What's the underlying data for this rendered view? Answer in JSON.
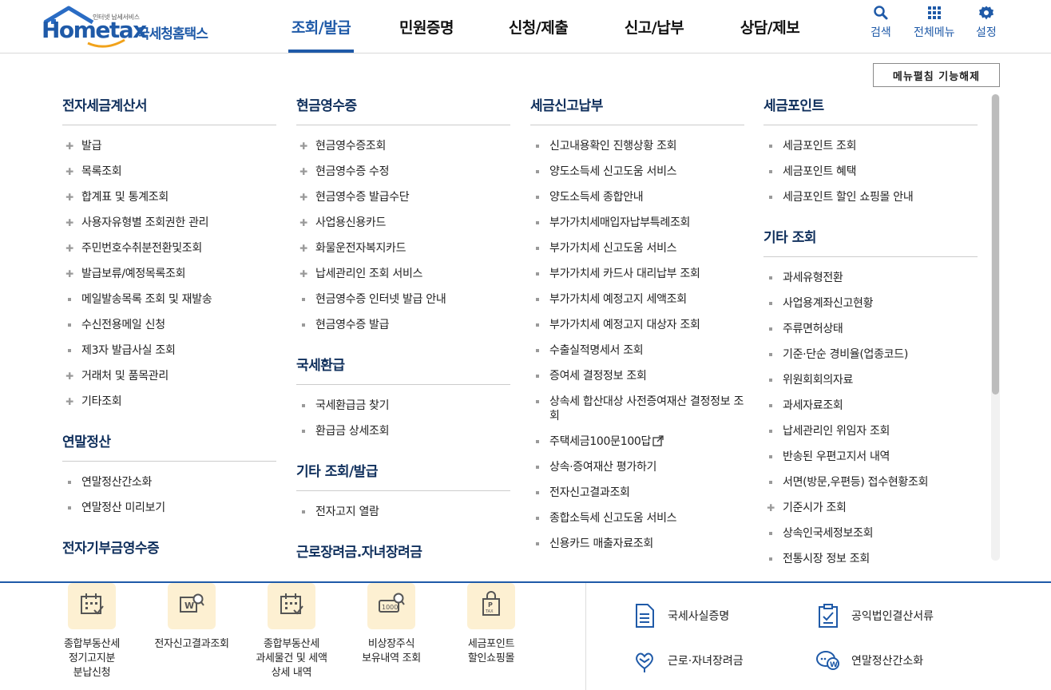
{
  "header": {
    "logo_tagline": "인터넷 납세서비스",
    "logo_en": "Hometax",
    "logo_ko": "국세청홈택스",
    "nav": [
      "조회/발급",
      "민원증명",
      "신청/제출",
      "신고/납부",
      "상담/제보"
    ],
    "active_nav": "조회/발급",
    "utils": {
      "search": "검색",
      "all_menu": "전체메뉴",
      "settings": "설정"
    }
  },
  "fold_button": "메뉴펼침 기능해제",
  "columns": [
    {
      "sections": [
        {
          "title": "전자세금계산서",
          "items": [
            {
              "label": "발급",
              "bullet": "plus"
            },
            {
              "label": "목록조회",
              "bullet": "plus"
            },
            {
              "label": "합계표 및 통계조회",
              "bullet": "plus"
            },
            {
              "label": "사용자유형별 조회권한 관리",
              "bullet": "plus"
            },
            {
              "label": "주민번호수취분전환및조회",
              "bullet": "plus"
            },
            {
              "label": "발급보류/예정목록조회",
              "bullet": "plus"
            },
            {
              "label": "메일발송목록 조회 및 재발송",
              "bullet": "dot"
            },
            {
              "label": "수신전용메일 신청",
              "bullet": "dot"
            },
            {
              "label": "제3자 발급사실 조회",
              "bullet": "dot"
            },
            {
              "label": "거래처 및 품목관리",
              "bullet": "plus"
            },
            {
              "label": "기타조회",
              "bullet": "plus"
            }
          ]
        },
        {
          "title": "연말정산",
          "items": [
            {
              "label": "연말정산간소화",
              "bullet": "dot"
            },
            {
              "label": "연말정산 미리보기",
              "bullet": "dot"
            }
          ]
        },
        {
          "title": "전자기부금영수증",
          "items": []
        }
      ]
    },
    {
      "sections": [
        {
          "title": "현금영수증",
          "items": [
            {
              "label": "현금영수증조회",
              "bullet": "plus"
            },
            {
              "label": "현금영수증 수정",
              "bullet": "plus"
            },
            {
              "label": "현금영수증 발급수단",
              "bullet": "plus"
            },
            {
              "label": "사업용신용카드",
              "bullet": "plus"
            },
            {
              "label": "화물운전자복지카드",
              "bullet": "plus"
            },
            {
              "label": "납세관리인 조회 서비스",
              "bullet": "plus"
            },
            {
              "label": "현금영수증 인터넷 발급 안내",
              "bullet": "dot"
            },
            {
              "label": "현금영수증 발급",
              "bullet": "dot"
            }
          ]
        },
        {
          "title": "국세환급",
          "items": [
            {
              "label": "국세환급금 찾기",
              "bullet": "dot"
            },
            {
              "label": "환급금 상세조회",
              "bullet": "dot"
            }
          ]
        },
        {
          "title": "기타 조회/발급",
          "items": [
            {
              "label": "전자고지 열람",
              "bullet": "dot"
            }
          ]
        },
        {
          "title": "근로장려금.자녀장려금",
          "items": []
        }
      ]
    },
    {
      "sections": [
        {
          "title": "세금신고납부",
          "items": [
            {
              "label": "신고내용확인 진행상황 조회",
              "bullet": "dot"
            },
            {
              "label": "양도소득세 신고도움 서비스",
              "bullet": "dot"
            },
            {
              "label": "양도소득세 종합안내",
              "bullet": "dot"
            },
            {
              "label": "부가가치세매입자납부특례조회",
              "bullet": "dot"
            },
            {
              "label": "부가가치세 신고도움 서비스",
              "bullet": "dot"
            },
            {
              "label": "부가가치세 카드사 대리납부 조회",
              "bullet": "dot"
            },
            {
              "label": "부가가치세 예정고지 세액조회",
              "bullet": "dot"
            },
            {
              "label": "부가가치세 예정고지 대상자 조회",
              "bullet": "dot"
            },
            {
              "label": "수출실적명세서 조회",
              "bullet": "dot"
            },
            {
              "label": "증여세 결정정보 조회",
              "bullet": "dot"
            },
            {
              "label": "상속세 합산대상 사전증여재산 결정정보 조회",
              "bullet": "dot"
            },
            {
              "label": "주택세금100문100답",
              "bullet": "dot",
              "external": true
            },
            {
              "label": "상속·증여재산 평가하기",
              "bullet": "dot"
            },
            {
              "label": "전자신고결과조회",
              "bullet": "dot"
            },
            {
              "label": "종합소득세 신고도움 서비스",
              "bullet": "dot"
            },
            {
              "label": "신용카드 매출자료조회",
              "bullet": "dot"
            }
          ]
        }
      ]
    },
    {
      "sections": [
        {
          "title": "세금포인트",
          "items": [
            {
              "label": "세금포인트 조회",
              "bullet": "dot"
            },
            {
              "label": "세금포인트 혜택",
              "bullet": "dot"
            },
            {
              "label": "세금포인트 할인 쇼핑몰 안내",
              "bullet": "dot"
            }
          ]
        },
        {
          "title": "기타 조회",
          "items": [
            {
              "label": "과세유형전환",
              "bullet": "dot"
            },
            {
              "label": "사업용계좌신고현황",
              "bullet": "dot"
            },
            {
              "label": "주류면허상태",
              "bullet": "dot"
            },
            {
              "label": "기준·단순 경비율(업종코드)",
              "bullet": "dot"
            },
            {
              "label": "위원회회의자료",
              "bullet": "dot"
            },
            {
              "label": "과세자료조회",
              "bullet": "dot"
            },
            {
              "label": "납세관리인 위임자 조회",
              "bullet": "dot"
            },
            {
              "label": "반송된 우편고지서 내역",
              "bullet": "dot"
            },
            {
              "label": "서면(방문,우편등) 접수현황조회",
              "bullet": "dot"
            },
            {
              "label": "기준시가 조회",
              "bullet": "plus"
            },
            {
              "label": "상속인국세정보조회",
              "bullet": "dot"
            },
            {
              "label": "전통시장 정보 조회",
              "bullet": "dot"
            }
          ]
        }
      ]
    }
  ],
  "quick_left": [
    {
      "label": "종합부동산세\n정기고지분\n분납신청",
      "icon": "calendar-check-icon"
    },
    {
      "label": "전자신고결과조회",
      "icon": "won-search-icon"
    },
    {
      "label": "종합부동산세\n과세물건 및 세액\n상세 내역",
      "icon": "calendar-check-icon"
    },
    {
      "label": "비상장주식\n보유내역 조회",
      "icon": "stock-search-icon"
    },
    {
      "label": "세금포인트\n할인쇼핑몰",
      "icon": "shopping-bag-icon"
    }
  ],
  "quick_right": [
    {
      "label": "국세사실증명",
      "icon": "document-icon"
    },
    {
      "label": "공익법인결산서류",
      "icon": "clipboard-check-icon"
    },
    {
      "label": "근로·자녀장려금",
      "icon": "heart-hands-icon"
    },
    {
      "label": "연말정산간소화",
      "icon": "won-chat-icon"
    }
  ],
  "colors": {
    "brand": "#1f5aa8",
    "section_title": "#0f2f5c",
    "quick_bg": "#fdf0d2"
  }
}
